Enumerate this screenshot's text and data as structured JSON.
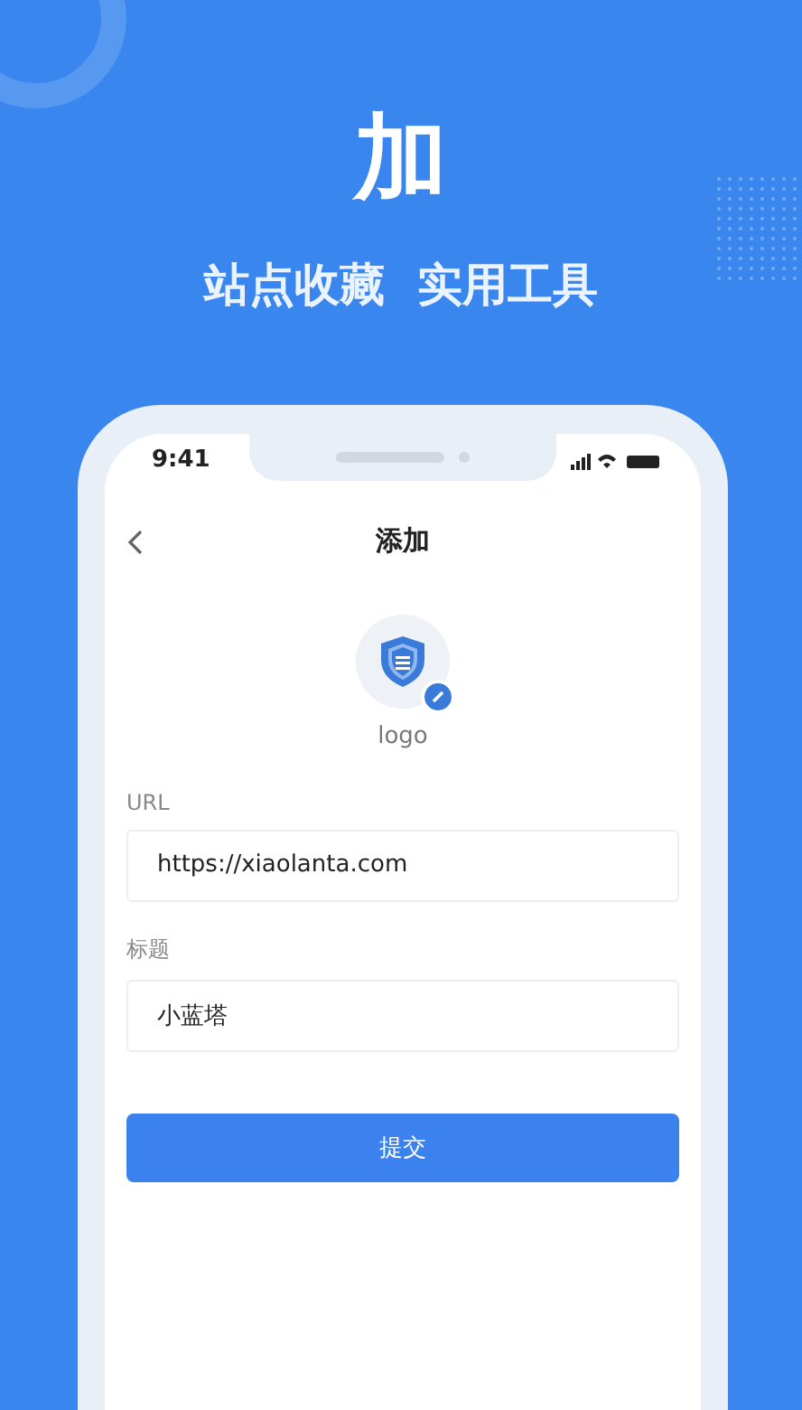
{
  "hero": {
    "title": "加",
    "taglines": [
      "站点收藏",
      "实用工具"
    ]
  },
  "phone": {
    "status_bar": {
      "time": "9:41"
    },
    "nav": {
      "title": "添加"
    },
    "logo": {
      "caption": "logo"
    },
    "fields": [
      {
        "label": "URL",
        "value": "https://xiaolanta.com"
      },
      {
        "label": "标题",
        "value": "小蓝塔"
      }
    ],
    "submit": "提交"
  }
}
